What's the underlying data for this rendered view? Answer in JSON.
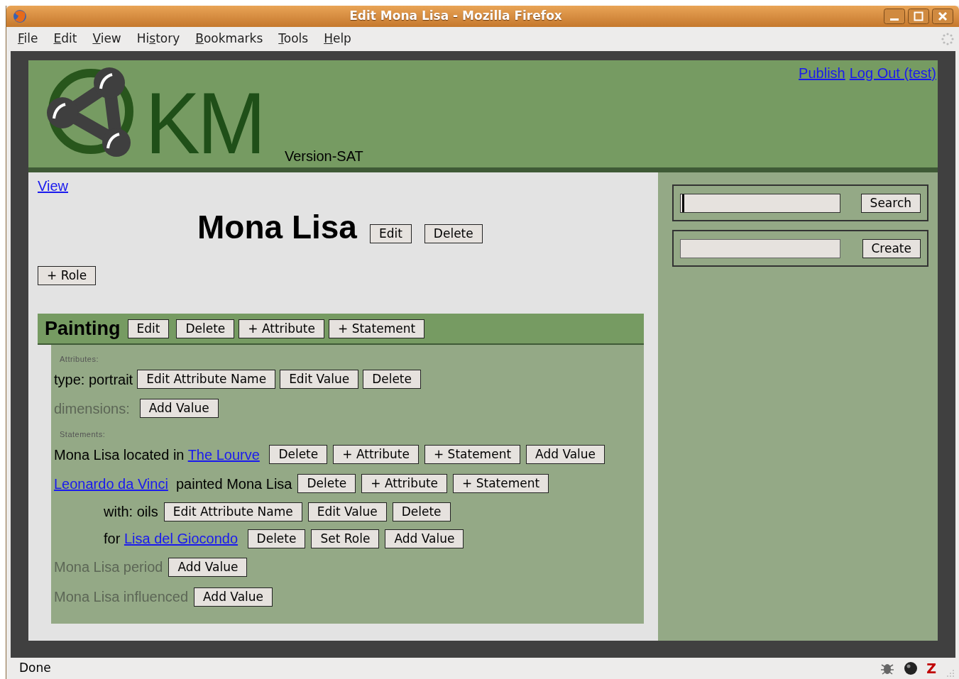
{
  "window": {
    "title": "Edit Mona Lisa - Mozilla Firefox"
  },
  "menu": [
    {
      "key": "F",
      "post": "ile"
    },
    {
      "key": "E",
      "post": "dit"
    },
    {
      "key": "V",
      "post": "iew"
    },
    {
      "pre": "Hi",
      "key": "s",
      "post": "tory"
    },
    {
      "key": "B",
      "post": "ookmarks"
    },
    {
      "key": "T",
      "post": "ools"
    },
    {
      "key": "H",
      "post": "elp"
    }
  ],
  "header": {
    "logo_text": "KM",
    "version": "Version-SAT",
    "links": [
      "Publish",
      "Log Out (test)"
    ]
  },
  "nav_link": "View",
  "topic": {
    "title": "Mona Lisa",
    "buttons": [
      "Edit",
      "Delete"
    ]
  },
  "role_button": "+ Role",
  "section": {
    "title": "Painting",
    "buttons": [
      "Edit",
      "Delete",
      "+ Attribute",
      "+ Statement"
    ],
    "attributes_label": "Attributes:",
    "attributes": [
      {
        "kind": "filled",
        "text": "type: portrait",
        "buttons": [
          "Edit Attribute Name",
          "Edit Value",
          "Delete"
        ]
      },
      {
        "kind": "empty",
        "text": "dimensions:",
        "buttons": [
          "Add Value"
        ]
      }
    ],
    "statements_label": "Statements:",
    "statements": [
      {
        "kind": "filled",
        "parts": [
          {
            "kind": "text",
            "text": "Mona Lisa located in "
          },
          {
            "kind": "link",
            "text": "The Lourve"
          }
        ],
        "buttons": [
          "Delete",
          "+ Attribute",
          "+ Statement",
          "Add Value"
        ]
      },
      {
        "kind": "filled",
        "parts": [
          {
            "kind": "link",
            "text": "Leonardo da Vinci"
          },
          {
            "kind": "text",
            "text": " painted Mona Lisa"
          }
        ],
        "buttons": [
          "Delete",
          "+ Attribute",
          "+ Statement"
        ],
        "children": [
          {
            "parts": [
              {
                "kind": "text",
                "text": "with: oils"
              }
            ],
            "buttons": [
              "Edit Attribute Name",
              "Edit Value",
              "Delete"
            ]
          },
          {
            "parts": [
              {
                "kind": "text",
                "text": "for "
              },
              {
                "kind": "link",
                "text": "Lisa del Giocondo"
              }
            ],
            "buttons": [
              "Delete",
              "Set Role",
              "Add Value"
            ]
          }
        ]
      },
      {
        "kind": "empty",
        "parts": [
          {
            "kind": "text",
            "text": "Mona Lisa period"
          }
        ],
        "buttons": [
          "Add Value"
        ]
      },
      {
        "kind": "empty",
        "parts": [
          {
            "kind": "text",
            "text": "Mona Lisa influenced"
          }
        ],
        "buttons": [
          "Add Value"
        ]
      }
    ]
  },
  "sidebar": {
    "forms": [
      {
        "button": "Search",
        "focused": true
      },
      {
        "button": "Create",
        "focused": false
      }
    ]
  },
  "status_bar": {
    "text": "Done",
    "addon_glyph": "Z"
  }
}
